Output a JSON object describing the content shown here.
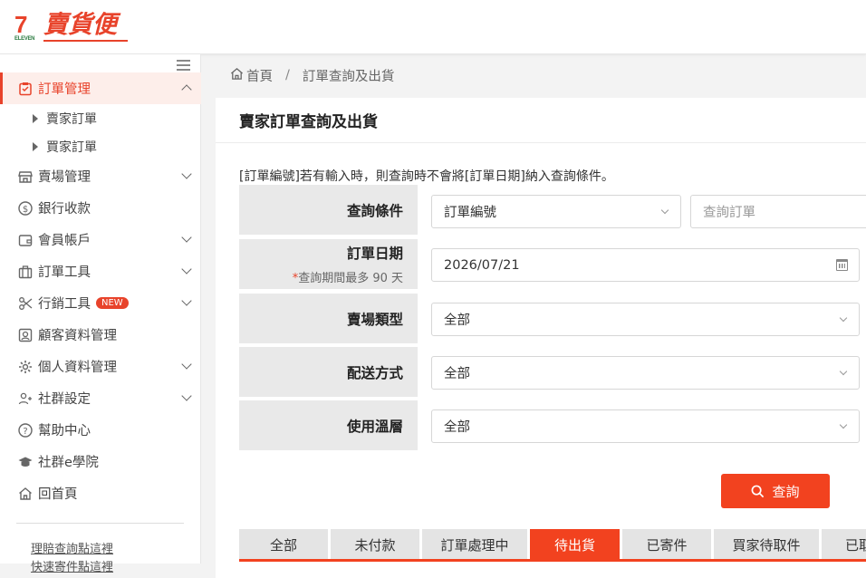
{
  "brand": {
    "logo_mark": "7",
    "logo_sub": "ELEVEN",
    "logo_text": "賣貨便"
  },
  "sidebar": {
    "items": [
      {
        "label": "訂單管理",
        "icon": "order-check-icon"
      },
      {
        "label": "賣場管理",
        "icon": "store-icon"
      },
      {
        "label": "銀行收款",
        "icon": "dollar-icon"
      },
      {
        "label": "會員帳戶",
        "icon": "wallet-icon"
      },
      {
        "label": "訂單工具",
        "icon": "briefcase-icon"
      },
      {
        "label": "行銷工具",
        "icon": "scissors-icon",
        "badge": "NEW"
      },
      {
        "label": "顧客資料管理",
        "icon": "contact-icon"
      },
      {
        "label": "個人資料管理",
        "icon": "gear-icon"
      },
      {
        "label": "社群設定",
        "icon": "users-icon"
      },
      {
        "label": "幫助中心",
        "icon": "question-icon"
      },
      {
        "label": "社群e學院",
        "icon": "graduation-cap-icon"
      },
      {
        "label": "回首頁",
        "icon": "home-icon"
      }
    ],
    "sub_items": [
      {
        "label": "賣家訂單"
      },
      {
        "label": "買家訂單"
      }
    ],
    "links": [
      "理賠查詢點這裡",
      "快速寄件點這裡"
    ]
  },
  "breadcrumb": {
    "home": "首頁",
    "separator": "/",
    "current": "訂單查詢及出貨"
  },
  "card": {
    "title": "賣家訂單查詢及出貨",
    "notice": "[訂單編號]若有輸入時，則查詢時不會將[訂單日期]納入查詢條件。"
  },
  "form": {
    "query_condition": {
      "label": "查詢條件",
      "selected": "訂單編號",
      "input_placeholder": "查詢訂單"
    },
    "order_date": {
      "label": "訂單日期",
      "star": "*",
      "hint": "查詢期間最多 90 天",
      "value": "2026/07/21"
    },
    "store_type": {
      "label": "賣場類型",
      "selected": "全部"
    },
    "delivery": {
      "label": "配送方式",
      "selected": "全部"
    },
    "temperature": {
      "label": "使用溫層",
      "selected": "全部"
    },
    "search_button": "查詢"
  },
  "tabs": [
    "全部",
    "未付款",
    "訂單處理中",
    "待出貨",
    "已寄件",
    "買家待取件",
    "已取件"
  ],
  "active_tab": "待出貨",
  "colors": {
    "accent": "#f2421f",
    "brand_red": "#e8432b",
    "active_bg": "#fdeeea"
  }
}
